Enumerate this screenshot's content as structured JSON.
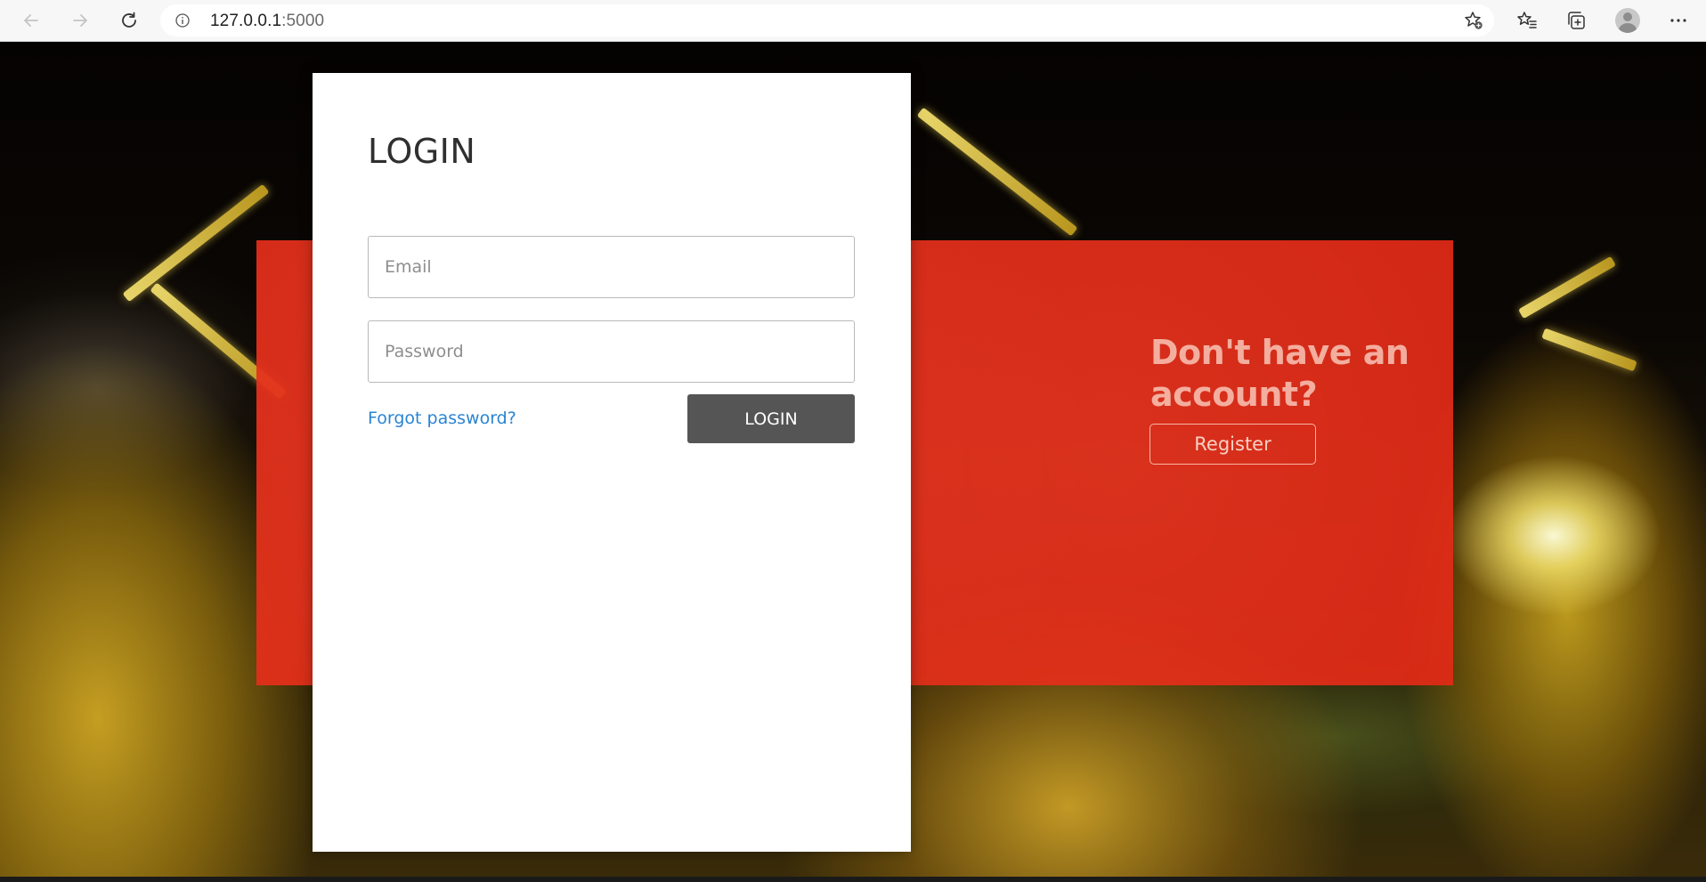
{
  "browser": {
    "url_host": "127.0.0.1",
    "url_port": ":5000",
    "icons": {
      "back": "arrow-left-icon",
      "forward": "arrow-right-icon",
      "reload": "reload-icon",
      "site_info": "info-icon",
      "add_favorite": "star-plus-icon",
      "favorites": "favorites-icon",
      "collections": "collections-icon",
      "profile": "profile-avatar",
      "menu": "ellipsis-icon"
    }
  },
  "login": {
    "title": "LOGIN",
    "email_placeholder": "Email",
    "password_placeholder": "Password",
    "forgot_label": "Forgot password?",
    "submit_label": "LOGIN"
  },
  "signup": {
    "prompt": "Don't have an account?",
    "register_label": "Register"
  },
  "colors": {
    "panel_red": "#e12814",
    "login_button": "#555555",
    "link_blue": "#2a84d2",
    "card_background": "#ffffff"
  }
}
